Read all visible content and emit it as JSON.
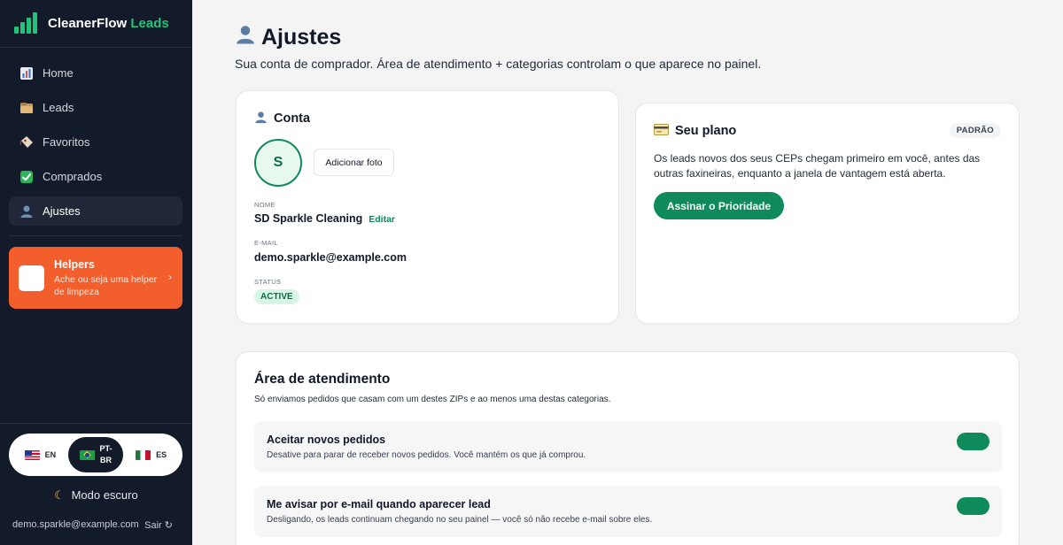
{
  "brand": {
    "name": "CleanerFlow",
    "accent": "Leads"
  },
  "nav": [
    {
      "label": "Home",
      "icon": "bar-chart-icon"
    },
    {
      "label": "Leads",
      "icon": "folder-icon"
    },
    {
      "label": "Favoritos",
      "icon": "tag-icon"
    },
    {
      "label": "Comprados",
      "icon": "check-box-icon"
    },
    {
      "label": "Ajustes",
      "icon": "user-icon",
      "active": true
    }
  ],
  "helpers": {
    "title": "Helpers",
    "subtitle": "Ache ou seja uma helper de limpeza"
  },
  "languages": [
    {
      "code": "EN"
    },
    {
      "code_line1": "PT-",
      "code_line2": "BR",
      "selected": true
    },
    {
      "code": "ES"
    }
  ],
  "dark_mode_label": "Modo escuro",
  "footer": {
    "email": "demo.sparkle@example.com",
    "logout": "Sair"
  },
  "page": {
    "title": "Ajustes",
    "subtitle": "Sua conta de comprador. Área de atendimento + categorias controlam o que aparece no painel."
  },
  "account": {
    "title": "Conta",
    "avatar_initial": "S",
    "add_photo": "Adicionar foto",
    "name_label": "NOME",
    "name_value": "SD Sparkle Cleaning",
    "edit_label": "Editar",
    "email_label": "E-MAIL",
    "email_value": "demo.sparkle@example.com",
    "status_label": "STATUS",
    "status_value": "ACTIVE"
  },
  "plan": {
    "title": "Seu plano",
    "badge": "PADRÃO",
    "description": "Os leads novos dos seus CEPs chegam primeiro em você, antes das outras faxineiras, enquanto a janela de vantagem está aberta.",
    "cta": "Assinar o Prioridade"
  },
  "service_area": {
    "title": "Área de atendimento",
    "subtitle": "Só enviamos pedidos que casam com um destes ZIPs e ao menos uma destas categorias.",
    "settings": [
      {
        "title": "Aceitar novos pedidos",
        "description": "Desative para parar de receber novos pedidos. Você mantém os que já comprou.",
        "enabled": true
      },
      {
        "title": "Me avisar por e-mail quando aparecer lead",
        "description": "Desligando, os leads continuam chegando no seu painel — você só não recebe e-mail sobre eles.",
        "enabled": true
      }
    ]
  },
  "colors": {
    "sidebar": "#131a2a",
    "accent_green": "#0f8a5a",
    "brand_green": "#22c37a",
    "helpers_orange": "#f25f2c"
  }
}
